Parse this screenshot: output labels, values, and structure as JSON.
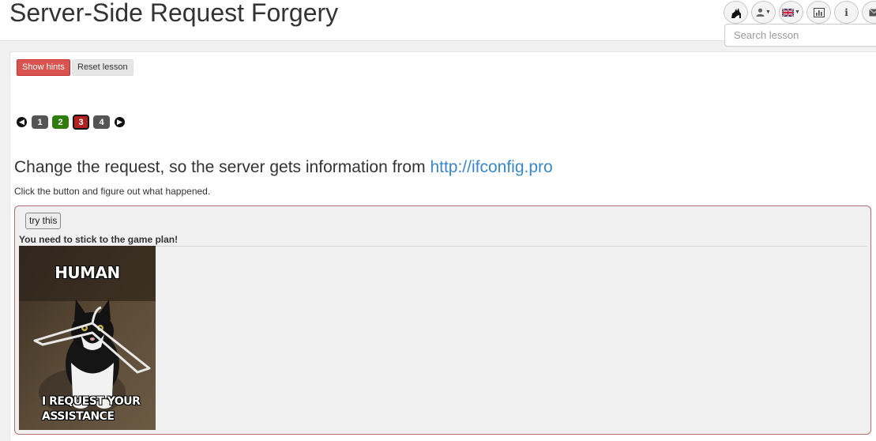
{
  "header": {
    "title": "Server-Side Request Forgery",
    "search_placeholder": "Search lesson",
    "toolbar_icons": [
      "wolf-logo-icon",
      "user-icon",
      "uk-flag-icon",
      "report-card-icon",
      "info-icon",
      "mail-icon"
    ]
  },
  "lesson": {
    "show_hints_label": "Show hints",
    "reset_lesson_label": "Reset lesson",
    "pages": [
      "1",
      "2",
      "3",
      "4"
    ],
    "current_page": "3",
    "heading_text": "Change the request, so the server gets information from ",
    "heading_link": "http://ifconfig.pro",
    "instruction": "Click the button and figure out what happened."
  },
  "attack": {
    "button_label": "try this",
    "feedback": "You need to stick to the game plan!",
    "meme_top_text": "HUMAN",
    "meme_bottom_text": "I REQUEST YOUR ASSISTANCE"
  },
  "colors": {
    "hints_button": "#d9534f",
    "page_completed": "#2e7d0e",
    "page_current": "#b22222",
    "page_default": "#555555",
    "link": "#3a87c7"
  }
}
